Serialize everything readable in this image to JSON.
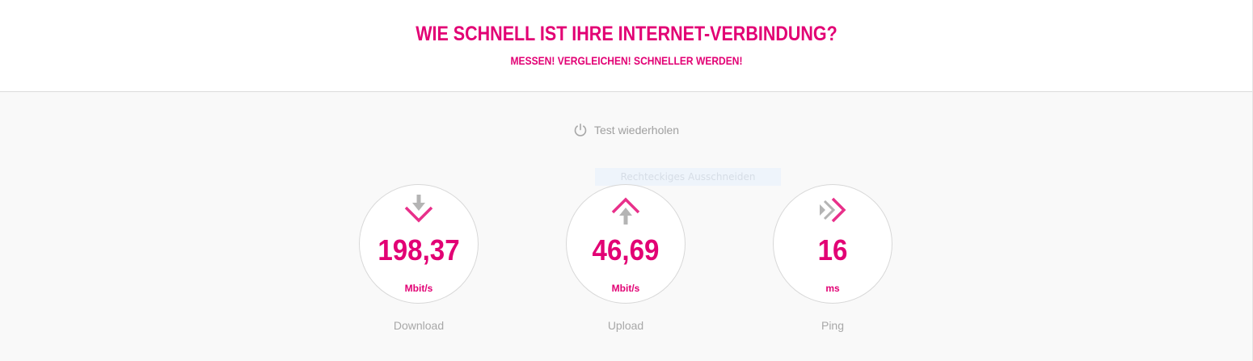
{
  "header": {
    "title": "WIE SCHNELL IST IHRE INTERNET-VERBINDUNG?",
    "subtitle": "MESSEN! VERGLEICHEN! SCHNELLER WERDEN!"
  },
  "repeat_test": {
    "label": "Test wiederholen",
    "icon": "power-icon"
  },
  "snipping_overlay": {
    "label": "Rechteckiges Ausschneiden"
  },
  "metrics": [
    {
      "name": "download",
      "value": "198,37",
      "unit": "Mbit/s",
      "label": "Download",
      "icon": "download-arrow-icon"
    },
    {
      "name": "upload",
      "value": "46,69",
      "unit": "Mbit/s",
      "label": "Upload",
      "icon": "upload-arrow-icon"
    },
    {
      "name": "ping",
      "value": "16",
      "unit": "ms",
      "label": "Ping",
      "icon": "ping-chevron-icon"
    }
  ],
  "colors": {
    "accent": "#e20074",
    "muted_text": "#a8a8a8",
    "icon_grey": "#b4b4b4",
    "background": "#f9f9f9"
  }
}
